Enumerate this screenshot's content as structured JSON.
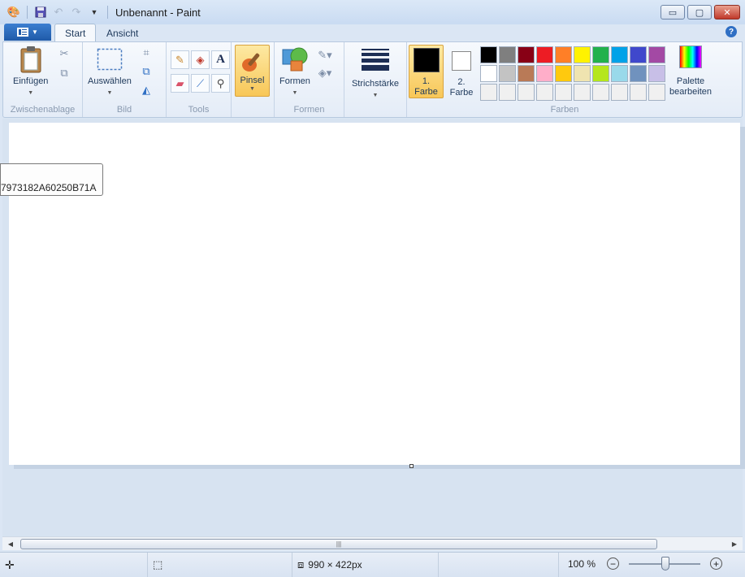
{
  "window": {
    "title": "Unbenannt - Paint",
    "controls": {
      "minimize": "▭",
      "maximize": "▢",
      "close": "✕"
    }
  },
  "quick_access": {
    "icons": [
      "paint-app-icon",
      "save-icon",
      "undo-icon",
      "redo-icon",
      "customize-dropdown-icon"
    ]
  },
  "tabs": [
    {
      "label": "Start",
      "active": true
    },
    {
      "label": "Ansicht",
      "active": false
    }
  ],
  "ribbon": {
    "clipboard": {
      "paste_label": "Einfügen",
      "group_label": "Zwischenablage"
    },
    "image": {
      "select_label": "Auswählen",
      "group_label": "Bild"
    },
    "tools": {
      "group_label": "Tools"
    },
    "brushes": {
      "label": "Pinsel"
    },
    "shapes": {
      "label": "Formen",
      "group_label": "Formen"
    },
    "size": {
      "label": "Strichstärke"
    },
    "colors": {
      "color1_label_line1": "1.",
      "color1_label_line2": "Farbe",
      "color2_label_line1": "2.",
      "color2_label_line2": "Farbe",
      "color1_value": "#000000",
      "color2_value": "#ffffff",
      "edit_line1": "Palette",
      "edit_line2": "bearbeiten",
      "group_label": "Farben",
      "palette": [
        "#000000",
        "#7f7f7f",
        "#880015",
        "#ed1c24",
        "#ff7f27",
        "#fff200",
        "#22b14c",
        "#00a2e8",
        "#3f48cc",
        "#a349a4",
        "#ffffff",
        "#c3c3c3",
        "#b97a57",
        "#ffaec9",
        "#ffc90e",
        "#efe4b0",
        "#b5e61d",
        "#99d9ea",
        "#7092be",
        "#c8bfe7",
        "#f0f0f0",
        "#f0f0f0",
        "#f0f0f0",
        "#f0f0f0",
        "#f0f0f0",
        "#f0f0f0",
        "#f0f0f0",
        "#f0f0f0",
        "#f0f0f0",
        "#f0f0f0"
      ]
    }
  },
  "tooltip": {
    "text": "7973182A60250B71A"
  },
  "status": {
    "canvas_size": "990 × 422px",
    "zoom": "100 %"
  }
}
